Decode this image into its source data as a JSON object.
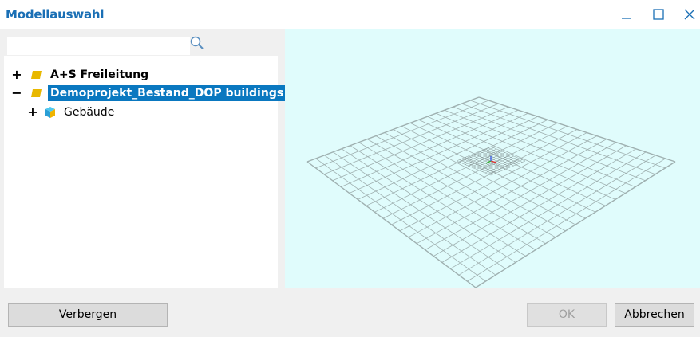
{
  "window": {
    "title": "Modellauswahl",
    "accent_color": "#1a6fb5"
  },
  "search": {
    "value": "",
    "placeholder": ""
  },
  "tree": {
    "items": [
      {
        "label": "A+S Freileitung",
        "expander": "+",
        "icon": "folder-icon",
        "bold": true,
        "selected": false
      },
      {
        "label": "Demoprojekt_Bestand_DOP buildings",
        "expander": "−",
        "icon": "folder-icon",
        "bold": true,
        "selected": true
      },
      {
        "label": "Gebäude",
        "expander": "+",
        "icon": "building-layer-icon",
        "bold": false,
        "selected": false
      }
    ],
    "selection_color": "#0a78c0"
  },
  "viewport": {
    "background": "#e0fcfc",
    "grid_color": "#9fb0b0"
  },
  "buttons": {
    "hide_label": "Verbergen",
    "ok_label": "OK",
    "cancel_label": "Abbrechen"
  }
}
